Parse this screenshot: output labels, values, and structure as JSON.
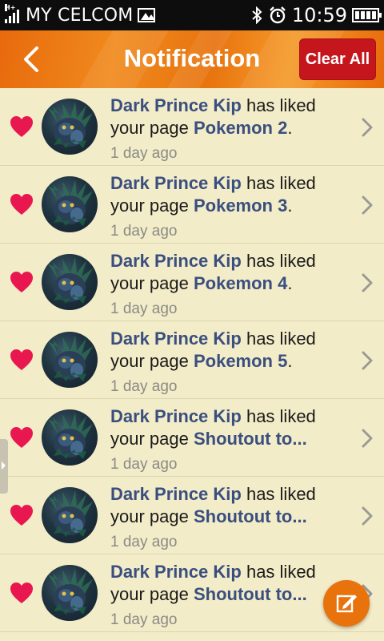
{
  "status_bar": {
    "carrier": "MY CELCOM",
    "network_type": "H+",
    "time": "10:59"
  },
  "header": {
    "title": "Notification",
    "clear_all_label": "Clear All",
    "accent": "#e8740f",
    "clear_color": "#c4161c"
  },
  "notifications": [
    {
      "actor": "Dark Prince Kip",
      "action": " has liked",
      "prefix": "your page ",
      "page": "Pokemon 2",
      "suffix": ".",
      "time": "1 day ago"
    },
    {
      "actor": "Dark Prince Kip",
      "action": " has liked",
      "prefix": "your page ",
      "page": "Pokemon 3",
      "suffix": ".",
      "time": "1 day ago"
    },
    {
      "actor": "Dark Prince Kip",
      "action": " has liked",
      "prefix": "your page ",
      "page": "Pokemon 4",
      "suffix": ".",
      "time": "1 day ago"
    },
    {
      "actor": "Dark Prince Kip",
      "action": " has liked",
      "prefix": "your page ",
      "page": "Pokemon 5",
      "suffix": ".",
      "time": "1 day ago"
    },
    {
      "actor": "Dark Prince Kip",
      "action": " has liked",
      "prefix": "your page ",
      "page": "Shoutout to...",
      "suffix": "",
      "time": "1 day ago"
    },
    {
      "actor": "Dark Prince Kip",
      "action": " has liked",
      "prefix": "your page ",
      "page": "Shoutout to...",
      "suffix": "",
      "time": "1 day ago"
    },
    {
      "actor": "Dark Prince Kip",
      "action": " has liked",
      "prefix": "your page ",
      "page": "Shoutout to...",
      "suffix": "",
      "time": "1 day ago"
    }
  ],
  "icons": {
    "row_reaction": "heart-icon",
    "row_open": "chevron-right-icon",
    "compose": "edit-icon",
    "back": "back-arrow-icon"
  },
  "colors": {
    "background": "#f3ecc8",
    "name_text": "#3a4f7f",
    "heart": "#e8174f"
  }
}
